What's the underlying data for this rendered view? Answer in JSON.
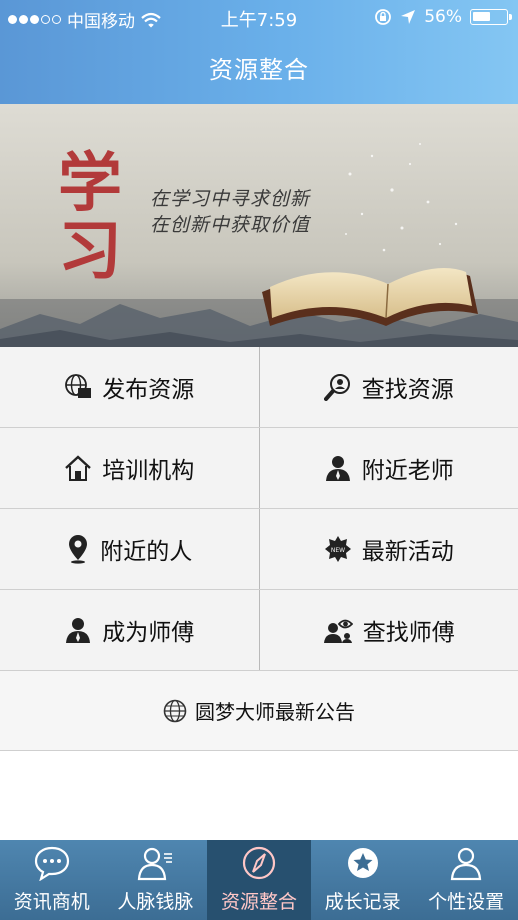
{
  "status_bar": {
    "carrier": "中国移动",
    "time": "上午7:59",
    "battery": "56%",
    "battery_level": 0.56
  },
  "nav": {
    "title": "资源整合"
  },
  "banner": {
    "calligraphy": "学习",
    "slogan_line1": "在学习中寻求创新",
    "slogan_line2": "在创新中获取价值"
  },
  "menu": [
    {
      "label": "发布资源",
      "icon": "globe-folder-icon"
    },
    {
      "label": "查找资源",
      "icon": "magnifier-person-icon"
    },
    {
      "label": "培训机构",
      "icon": "house-icon"
    },
    {
      "label": "附近老师",
      "icon": "person-icon"
    },
    {
      "label": "附近的人",
      "icon": "location-pin-icon"
    },
    {
      "label": "最新活动",
      "icon": "new-badge-icon"
    },
    {
      "label": "成为师傅",
      "icon": "person-icon"
    },
    {
      "label": "查找师傅",
      "icon": "eye-person-icon"
    }
  ],
  "announcement": {
    "label": "圆梦大师最新公告",
    "icon": "globe-icon"
  },
  "tabs": [
    {
      "label": "资讯商机",
      "icon": "chat-bubble-icon",
      "active": false
    },
    {
      "label": "人脉钱脉",
      "icon": "contacts-icon",
      "active": false
    },
    {
      "label": "资源整合",
      "icon": "compass-icon",
      "active": true
    },
    {
      "label": "成长记录",
      "icon": "star-badge-icon",
      "active": false
    },
    {
      "label": "个性设置",
      "icon": "user-icon",
      "active": false
    }
  ],
  "colors": {
    "header_start": "#5a97d6",
    "header_end": "#84c6f3",
    "tabbar": "#3c6d94",
    "tab_active_bg": "#27506f",
    "tab_active_text": "#ffc7c7",
    "calligraphy_red": "#b23a3a"
  }
}
